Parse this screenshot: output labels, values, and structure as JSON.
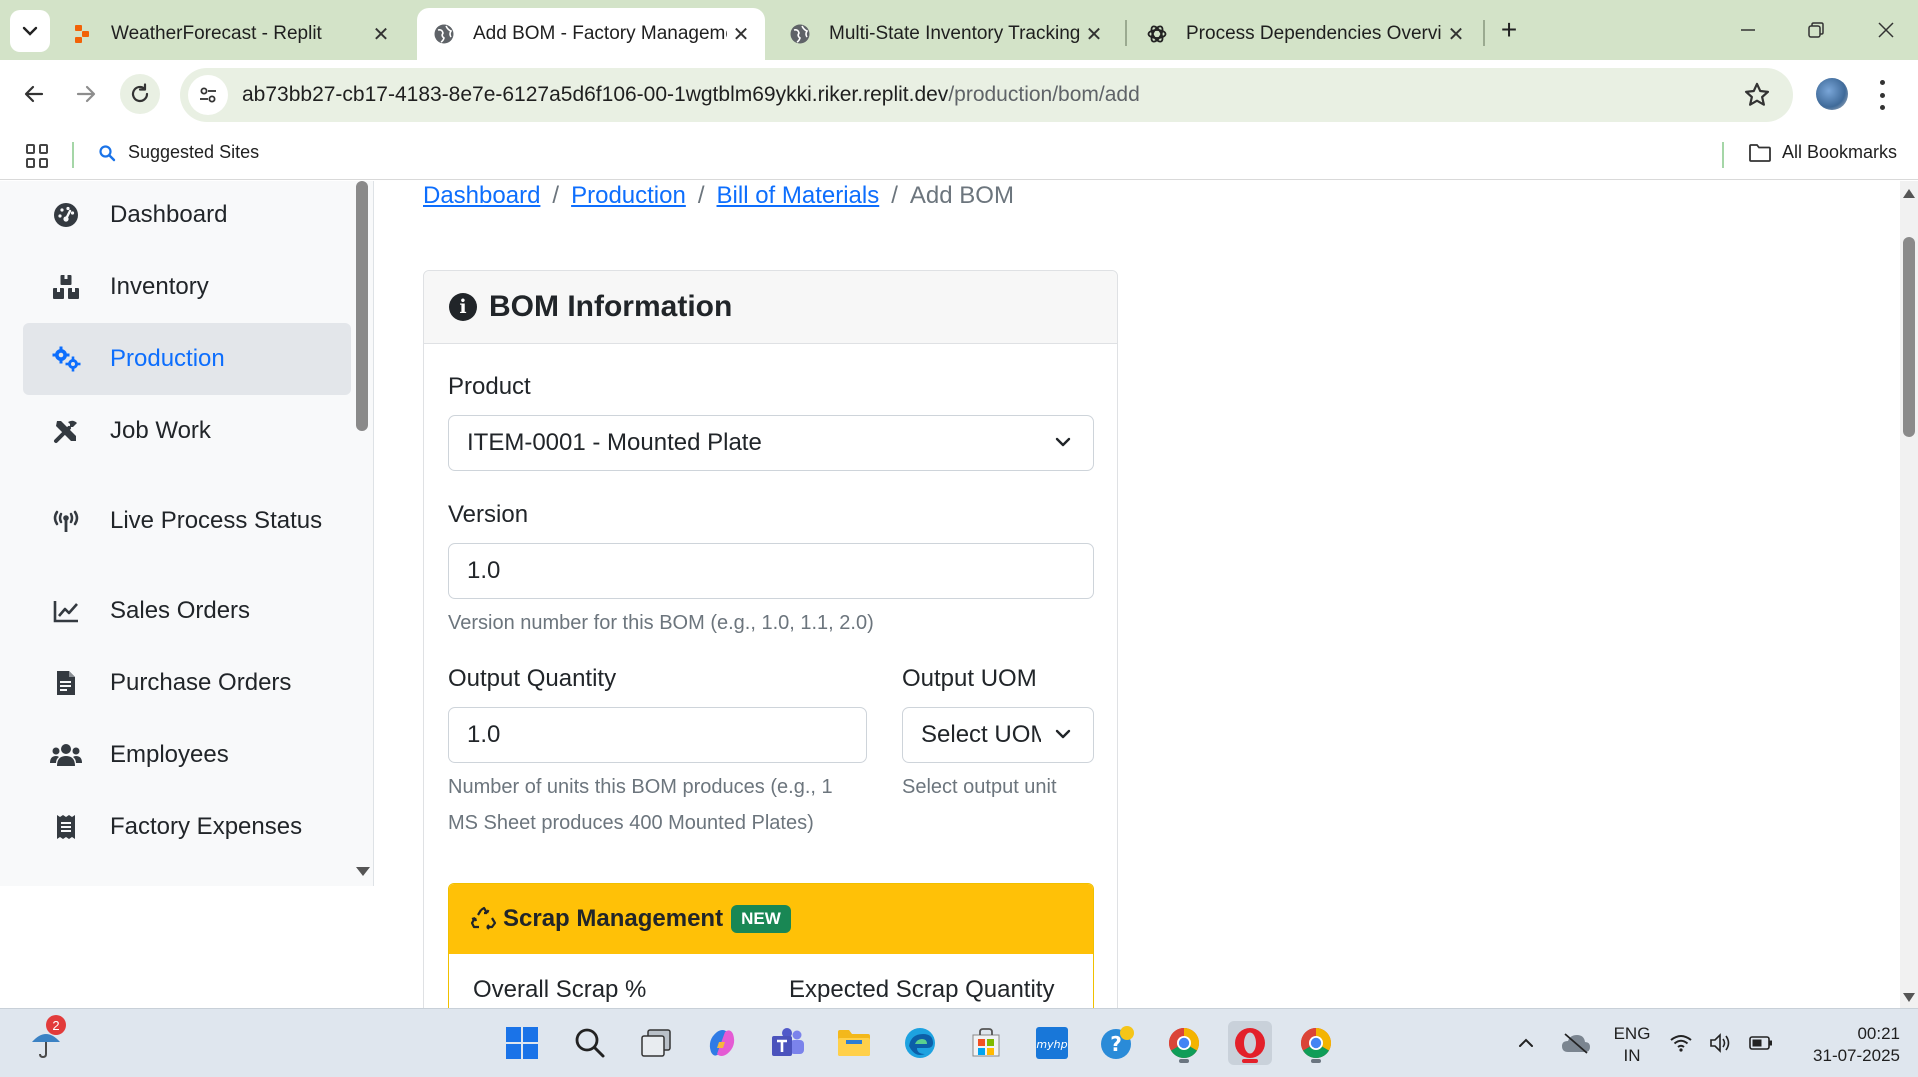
{
  "browser": {
    "tabs": [
      {
        "title": "WeatherForecast - Replit",
        "active": false,
        "favicon": "replit-icon"
      },
      {
        "title": "Add BOM - Factory Management",
        "active": true,
        "favicon": "globe-icon"
      },
      {
        "title": "Multi-State Inventory Tracking",
        "active": false,
        "favicon": "globe-icon"
      },
      {
        "title": "Process Dependencies Overview",
        "active": false,
        "favicon": "chatgpt-icon"
      }
    ],
    "url_host": "ab73bb27-cb17-4183-8e7e-6127a5d6f106-00-1wgtblm69ykki.riker.replit.dev",
    "url_path": "/production/bom/add",
    "bookmarks": {
      "suggested": "Suggested Sites",
      "all": "All Bookmarks"
    }
  },
  "sidebar": {
    "items": [
      {
        "label": "Dashboard",
        "icon": "gauge-icon"
      },
      {
        "label": "Inventory",
        "icon": "boxes-icon"
      },
      {
        "label": "Production",
        "icon": "cogs-icon",
        "active": true
      },
      {
        "label": "Job Work",
        "icon": "tools-icon"
      },
      {
        "label": "Live Process Status",
        "icon": "broadcast-icon"
      },
      {
        "label": "Sales Orders",
        "icon": "chart-line-icon"
      },
      {
        "label": "Purchase Orders",
        "icon": "file-invoice-icon"
      },
      {
        "label": "Employees",
        "icon": "users-icon"
      },
      {
        "label": "Factory Expenses",
        "icon": "receipt-icon"
      }
    ]
  },
  "breadcrumb": {
    "items": [
      "Dashboard",
      "Production",
      "Bill of Materials"
    ],
    "current": "Add BOM",
    "separator": "/"
  },
  "form": {
    "title": "BOM Information",
    "product": {
      "label": "Product",
      "value": "ITEM-0001 - Mounted Plate"
    },
    "version": {
      "label": "Version",
      "value": "1.0",
      "help": "Version number for this BOM (e.g., 1.0, 1.1, 2.0)"
    },
    "output_quantity": {
      "label": "Output Quantity",
      "value": "1.0",
      "help_line1": "Number of units this BOM produces (e.g., 1",
      "help_line2": "MS Sheet produces 400 Mounted Plates)"
    },
    "output_uom": {
      "label": "Output UOM",
      "value": "Select UOM",
      "help": "Select output unit"
    },
    "scrap": {
      "title": "Scrap Management",
      "badge": "NEW",
      "overall_label": "Overall Scrap %",
      "expected_label": "Expected Scrap Quantity"
    }
  },
  "taskbar": {
    "notification_count": "2",
    "lang_line1": "ENG",
    "lang_line2": "IN",
    "time": "00:21",
    "date": "31-07-2025"
  },
  "colors": {
    "accent": "#0d6efd",
    "scrap_header": "#ffc107",
    "badge_new": "#198754",
    "chrome_frame": "#d3e3c8"
  }
}
